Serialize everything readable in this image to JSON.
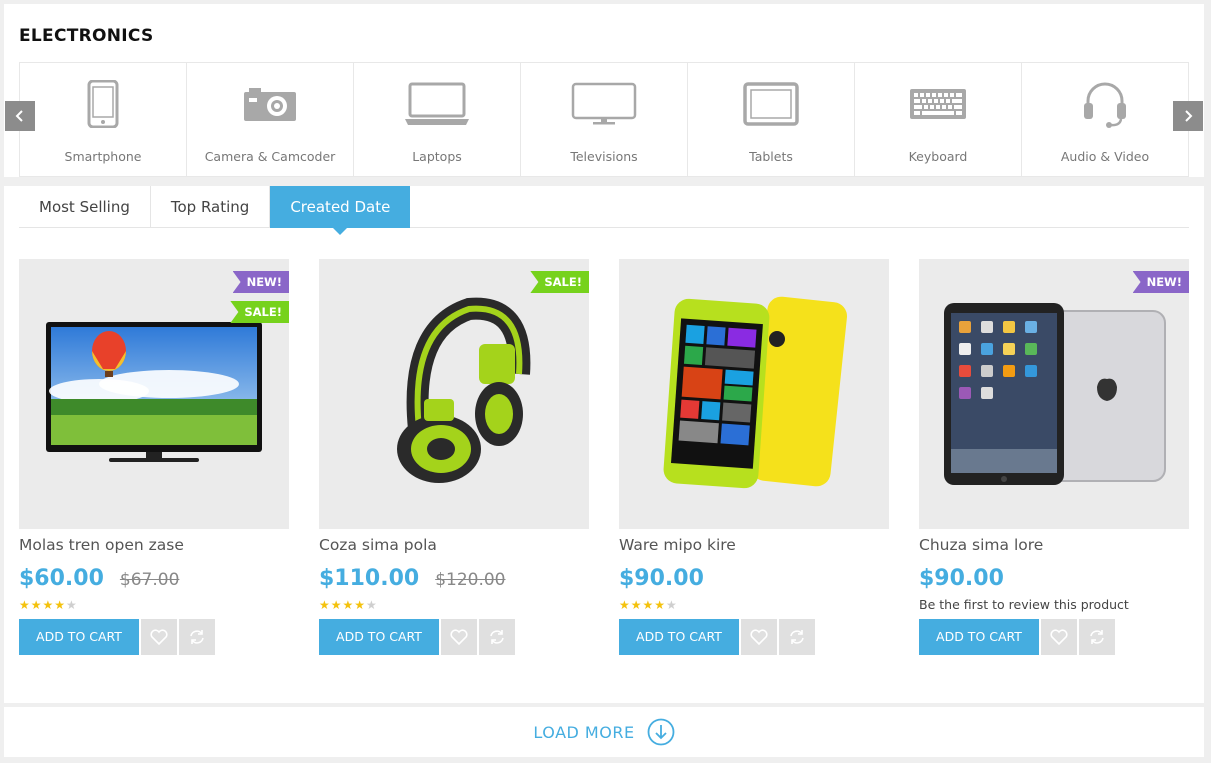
{
  "section": {
    "title": "ELECTRONICS"
  },
  "categories": [
    {
      "label": "Smartphone",
      "icon": "smartphone-icon"
    },
    {
      "label": "Camera & Camcoder",
      "icon": "camera-icon"
    },
    {
      "label": "Laptops",
      "icon": "laptop-icon"
    },
    {
      "label": "Televisions",
      "icon": "television-icon"
    },
    {
      "label": "Tablets",
      "icon": "tablet-icon"
    },
    {
      "label": "Keyboard",
      "icon": "keyboard-icon"
    },
    {
      "label": "Audio & Video",
      "icon": "headset-icon"
    }
  ],
  "tabs": [
    {
      "label": "Most Selling",
      "active": false
    },
    {
      "label": "Top Rating",
      "active": false
    },
    {
      "label": "Created Date",
      "active": true
    }
  ],
  "products": [
    {
      "name": "Molas tren open zase",
      "price": "$60.00",
      "old_price": "$67.00",
      "rating": 4.5,
      "badges": [
        "NEW!",
        "SALE!"
      ],
      "image": "television"
    },
    {
      "name": "Coza sima pola",
      "price": "$110.00",
      "old_price": "$120.00",
      "rating": 4,
      "badges": [
        "SALE!"
      ],
      "image": "headphones"
    },
    {
      "name": "Ware mipo kire",
      "price": "$90.00",
      "old_price": "",
      "rating": 4,
      "badges": [],
      "image": "smartphone"
    },
    {
      "name": "Chuza sima lore",
      "price": "$90.00",
      "old_price": "",
      "rating": null,
      "review_note": "Be the first to review this product",
      "badges": [
        "NEW!"
      ],
      "image": "tablet"
    }
  ],
  "labels": {
    "add_to_cart": "ADD TO CART",
    "load_more": "LOAD MORE"
  },
  "colors": {
    "accent": "#45ade0",
    "badge_new": "#8a66c8",
    "badge_sale": "#76d21c",
    "star": "#f4c20d"
  }
}
